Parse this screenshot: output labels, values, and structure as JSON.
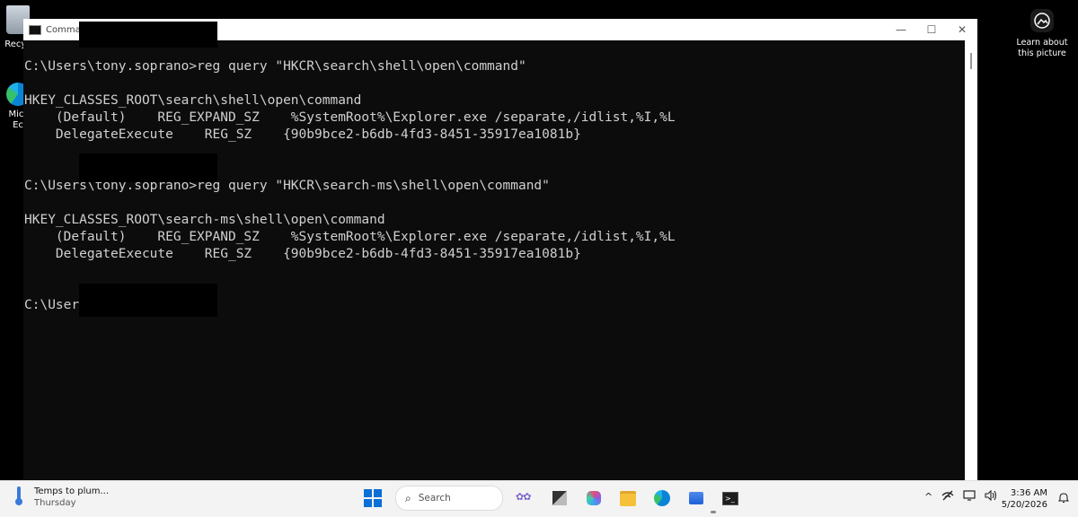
{
  "desktop": {
    "recycle_label": "Recyc",
    "edge_label_1": "Micr",
    "edge_label_2": "Ec",
    "learn_line1": "Learn about",
    "learn_line2": "this picture"
  },
  "window": {
    "title": "Comman",
    "controls": {
      "minimize": "—",
      "maximize": "☐",
      "close": "✕"
    }
  },
  "console": {
    "lines": [
      "C:\\Users\\tony.soprano>reg query \"HKCR\\search\\shell\\open\\command\"",
      "",
      "HKEY_CLASSES_ROOT\\search\\shell\\open\\command",
      "    (Default)    REG_EXPAND_SZ    %SystemRoot%\\Explorer.exe /separate,/idlist,%I,%L",
      "    DelegateExecute    REG_SZ    {90b9bce2-b6db-4fd3-8451-35917ea1081b}",
      "",
      "",
      "C:\\Users\\tony.soprano>reg query \"HKCR\\search-ms\\shell\\open\\command\"",
      "",
      "HKEY_CLASSES_ROOT\\search-ms\\shell\\open\\command",
      "    (Default)    REG_EXPAND_SZ    %SystemRoot%\\Explorer.exe /separate,/idlist,%I,%L",
      "    DelegateExecute    REG_SZ    {90b9bce2-b6db-4fd3-8451-35917ea1081b}",
      "",
      "",
      "C:\\User"
    ]
  },
  "taskbar": {
    "weather_title": "Temps to plum...",
    "weather_sub": "Thursday",
    "search_placeholder": "Search",
    "tray_chevron": "^",
    "time": "3:36 AM",
    "date": "5/20/2026"
  }
}
